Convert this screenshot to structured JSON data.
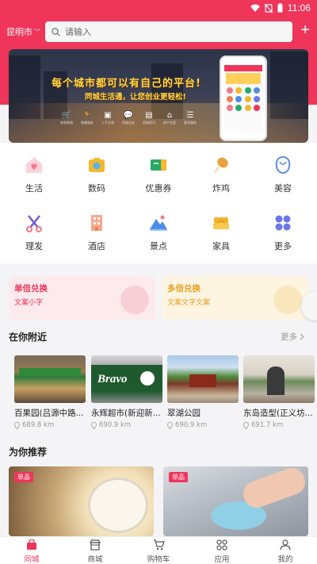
{
  "status_bar": {
    "time": "11:06"
  },
  "header": {
    "city": "昆明市",
    "search_placeholder": "请输入"
  },
  "banner": {
    "title": "每个城市都可以有自己的平台!",
    "subtitle": "同城生活通，让您创业更轻松!",
    "icons": [
      {
        "icon": "cart-icon",
        "label": "本地商城"
      },
      {
        "icon": "runner-icon",
        "label": "跑腿服务"
      },
      {
        "icon": "secondhand-icon",
        "label": "二手交易"
      },
      {
        "icon": "chat-icon",
        "label": "同城交友"
      },
      {
        "icon": "news-icon",
        "label": "同城资讯"
      },
      {
        "icon": "house-icon",
        "label": "房产信息"
      },
      {
        "icon": "db-icon",
        "label": "更多服务"
      }
    ]
  },
  "categories": [
    {
      "label": "生活",
      "icon": "house-heart-icon",
      "color": "#f07a8c"
    },
    {
      "label": "数码",
      "icon": "camera-icon",
      "color": "#f5b82e"
    },
    {
      "label": "优惠券",
      "icon": "coupon-icon",
      "color": "#2aaa66"
    },
    {
      "label": "炸鸡",
      "icon": "drumstick-icon",
      "color": "#e8a13a"
    },
    {
      "label": "美容",
      "icon": "face-icon",
      "color": "#5b8ed8"
    },
    {
      "label": "理发",
      "icon": "scissors-icon",
      "color": "#6f5ad6"
    },
    {
      "label": "酒店",
      "icon": "building-icon",
      "color": "#f0805a"
    },
    {
      "label": "景点",
      "icon": "mountain-icon",
      "color": "#4b8de8"
    },
    {
      "label": "家具",
      "icon": "sofa-icon",
      "color": "#f2b52a"
    },
    {
      "label": "更多",
      "icon": "grid-icon",
      "color": "#6a78e6"
    }
  ],
  "exchange": [
    {
      "title": "单倍兑换",
      "subtitle": "文案小字",
      "title_color": "#f0355a",
      "bg": "#fdeaed",
      "circle": "#f8cfd5"
    },
    {
      "title": "多倍兑换",
      "subtitle": "文案文字文案",
      "title_color": "#e7a021",
      "bg": "#fdf5e2",
      "circle": "#fbe7bc"
    }
  ],
  "nearby": {
    "title": "在你附近",
    "more": "更多",
    "items": [
      {
        "name": "百果园(吕源中路...",
        "distance": "689.8 km"
      },
      {
        "name": "永辉超市(新迎新...",
        "distance": "690.9 km"
      },
      {
        "name": "翠湖公园",
        "distance": "690.9 km"
      },
      {
        "name": "东岛造型(正义坊...",
        "distance": "691.7 km"
      }
    ]
  },
  "recommend": {
    "title": "为你推荐",
    "items": [
      {
        "badge": "单品"
      },
      {
        "badge": "单品"
      }
    ]
  },
  "tabs": [
    {
      "label": "同城",
      "icon": "bag-icon",
      "active": true
    },
    {
      "label": "商城",
      "icon": "store-icon",
      "active": false
    },
    {
      "label": "购物车",
      "icon": "cart-icon",
      "active": false
    },
    {
      "label": "应用",
      "icon": "apps-icon",
      "active": false
    },
    {
      "label": "我的",
      "icon": "person-icon",
      "active": false
    }
  ],
  "colors": {
    "brand": "#f0355a"
  }
}
